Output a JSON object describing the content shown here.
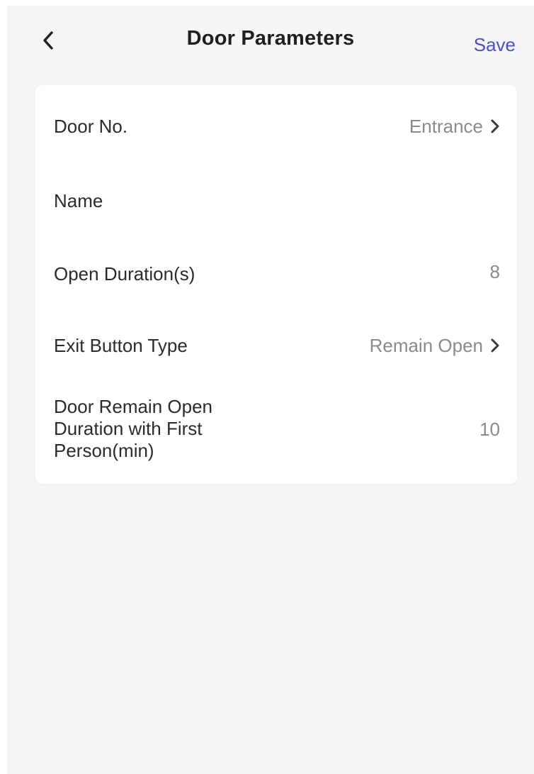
{
  "header": {
    "title": "Door Parameters",
    "save_label": "Save",
    "back_icon": "chevron-left-icon"
  },
  "colors": {
    "accent": "#4a4fcf",
    "background": "#f5f5f6",
    "card": "#ffffff",
    "label": "#2b2b2b",
    "value": "#8a8a8a"
  },
  "settings": {
    "door_no": {
      "label": "Door No.",
      "value": "Entrance"
    },
    "name": {
      "label": "Name",
      "value": ""
    },
    "open_duration": {
      "label": "Open Duration(s)",
      "value": "8"
    },
    "exit_button_type": {
      "label": "Exit Button Type",
      "value": "Remain Open"
    },
    "first_person": {
      "label_line1": "Door Remain Open",
      "label_line2": "Duration with First",
      "label_line3": "Person(min)",
      "value": "10"
    }
  }
}
